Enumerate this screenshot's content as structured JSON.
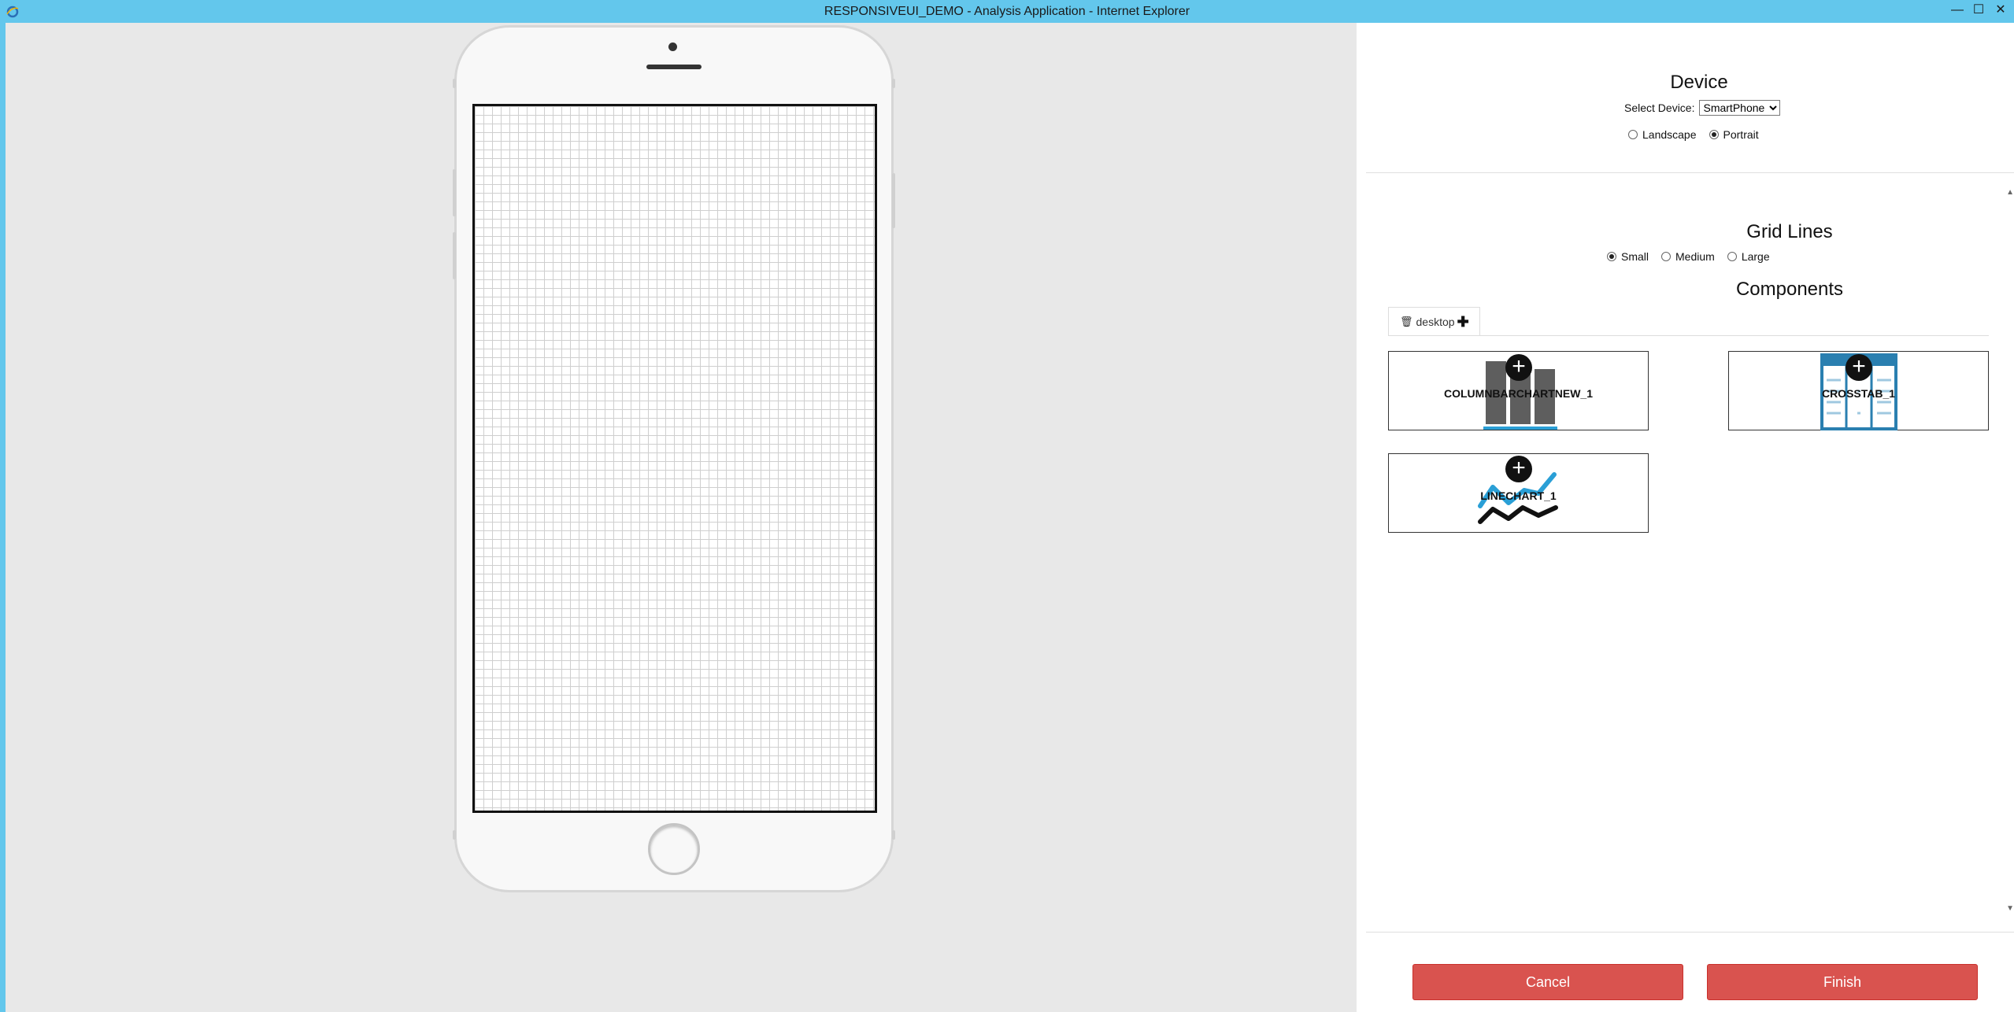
{
  "window": {
    "title": "RESPONSIVEUI_DEMO - Analysis Application - Internet Explorer",
    "minimize": "—",
    "maximize": "☐",
    "close": "✕"
  },
  "device_section": {
    "heading": "Device",
    "select_label": "Select Device:",
    "select_value": "SmartPhone",
    "orientation": {
      "options": [
        "Landscape",
        "Portrait"
      ],
      "selected": "Portrait"
    }
  },
  "grid_section": {
    "heading": "Grid Lines",
    "options": [
      "Small",
      "Medium",
      "Large"
    ],
    "selected": "Small"
  },
  "components_section": {
    "heading": "Components",
    "tab_label": "desktop",
    "items": [
      {
        "label": "COLUMNBARCHARTNEW_1",
        "icon": "column-chart-icon"
      },
      {
        "label": "CROSSTAB_1",
        "icon": "crosstab-icon"
      },
      {
        "label": "LINECHART_1",
        "icon": "line-chart-icon"
      }
    ]
  },
  "footer": {
    "cancel_label": "Cancel",
    "finish_label": "Finish"
  },
  "colors": {
    "titlebar": "#63c7ec",
    "accent_blue": "#2a9fd6",
    "button_red": "#d9534f"
  }
}
